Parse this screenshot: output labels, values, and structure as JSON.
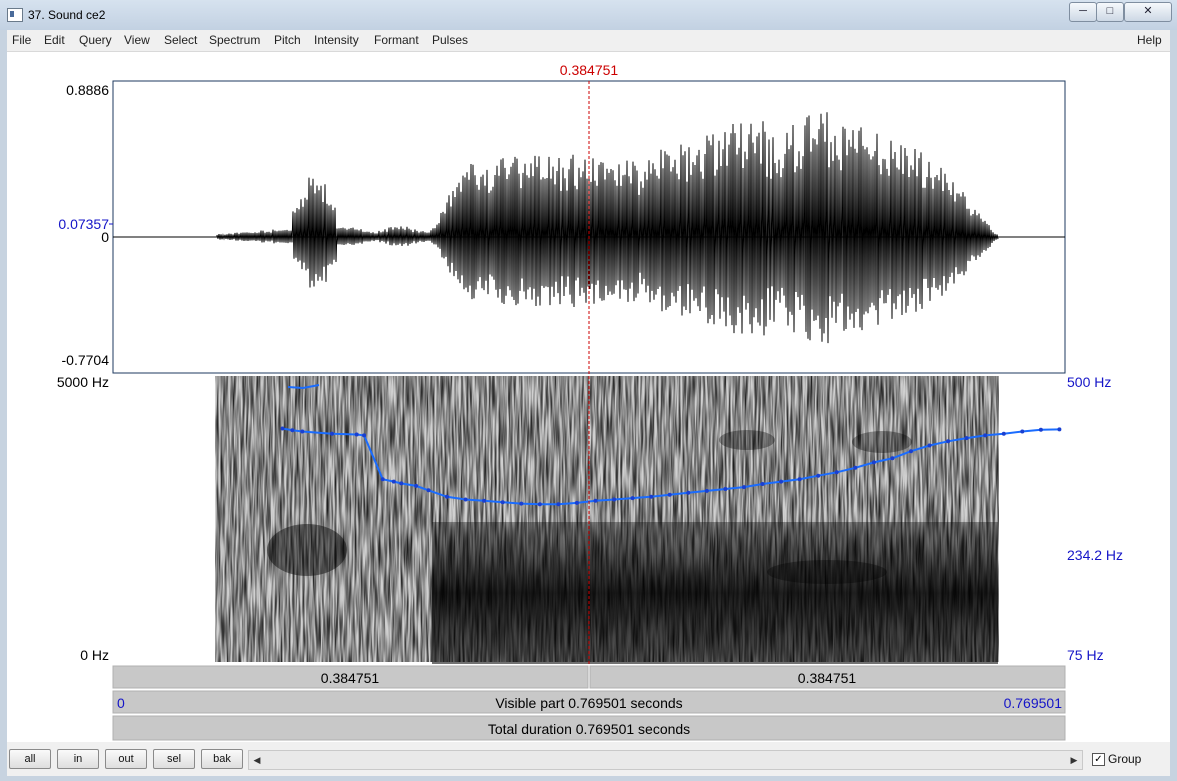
{
  "window": {
    "title": "37. Sound ce2"
  },
  "menu": {
    "items": [
      "File",
      "Edit",
      "Query",
      "View",
      "Select",
      "Spectrum",
      "Pitch",
      "Intensity",
      "Formant",
      "Pulses"
    ],
    "help": "Help"
  },
  "cursor": {
    "time_label": "0.384751"
  },
  "waveform": {
    "max_label": "0.8886",
    "cursor_value_label": "0.07357",
    "zero_label": "0",
    "min_label": "-0.7704"
  },
  "spectrogram": {
    "top_label": "5000 Hz",
    "bottom_label": "0 Hz"
  },
  "pitch": {
    "top_label": "500 Hz",
    "cursor_label": "234.2 Hz",
    "bottom_label": "75 Hz"
  },
  "time_bars": {
    "left_segment": "0.384751",
    "right_segment": "0.384751",
    "start": "0",
    "visible": "Visible part 0.769501 seconds",
    "end": "0.769501",
    "total": "Total duration 0.769501 seconds"
  },
  "bottom": {
    "buttons": [
      "all",
      "in",
      "out",
      "sel",
      "bak"
    ],
    "group_label": "Group",
    "group_checked": "✓"
  },
  "chart_data": {
    "type": "line",
    "title": "",
    "xlabel": "",
    "ylabel": "",
    "xlim": [
      0,
      0.769501
    ],
    "ylim": [
      75,
      500
    ],
    "y_scale": "log",
    "series": [
      {
        "x": [
          0.137,
          0.145,
          0.153,
          0.177,
          0.197,
          0.203,
          0.218,
          0.227,
          0.233,
          0.245,
          0.255,
          0.27,
          0.285,
          0.3,
          0.315,
          0.33,
          0.345,
          0.36,
          0.375,
          0.39,
          0.405,
          0.42,
          0.435,
          0.45,
          0.465,
          0.48,
          0.495,
          0.51,
          0.525,
          0.54,
          0.555,
          0.57,
          0.585,
          0.6,
          0.615,
          0.63,
          0.645,
          0.66,
          0.675,
          0.69,
          0.705,
          0.72,
          0.735,
          0.75,
          0.765
        ],
        "values": [
          354,
          350,
          347,
          342,
          340,
          338,
          252,
          248,
          245,
          241,
          234,
          224,
          220,
          218,
          216,
          214,
          213,
          213,
          215,
          218,
          220,
          222,
          224,
          227,
          230,
          233,
          236,
          239,
          244,
          248,
          252,
          258,
          264,
          272,
          282,
          290,
          304,
          316,
          325,
          332,
          338,
          342,
          347,
          351,
          352
        ]
      }
    ]
  }
}
